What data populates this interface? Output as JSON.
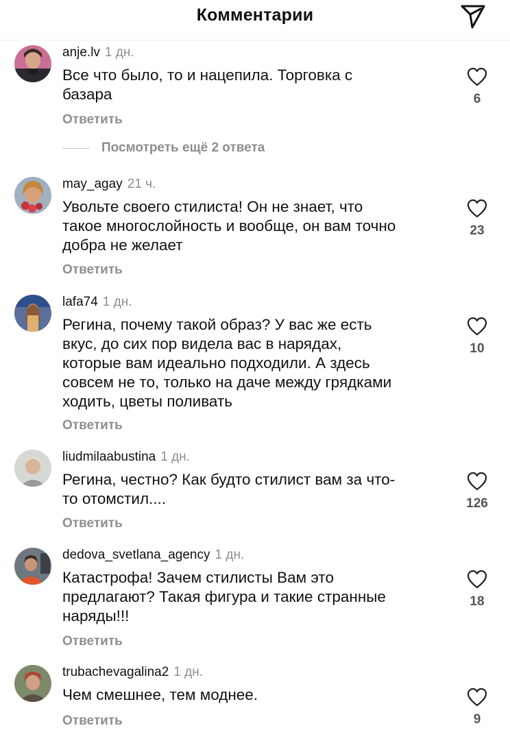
{
  "header": {
    "title": "Комментарии",
    "send_icon": "send-icon"
  },
  "colors": {
    "text": "#111111",
    "secondary": "#8e8e8e",
    "heart_outline": "#222222"
  },
  "comments": [
    {
      "username": "anje.lv",
      "time": "1 дн.",
      "text": "Все что было, то и нацепила. Торговка с\nбазара",
      "reply_label": "Ответить",
      "likes": "6"
    },
    {
      "username": "may_agay",
      "time": "21 ч.",
      "text": "Увольте своего стилиста! Он не знает, что\nтакое многослойность и вообще, он вам точно\nдобра не желает",
      "reply_label": "Ответить",
      "likes": "23"
    },
    {
      "username": "lafa74",
      "time": "1 дн.",
      "text": "Регина, почему такой образ? У вас же есть\nвкус, до сих пор видела вас в нарядах,\nкоторые  вам идеально подходили. А здесь\nсовсем не то, только на даче между грядками\nходить, цветы поливать",
      "reply_label": "Ответить",
      "likes": "10"
    },
    {
      "username": "liudmilaabustina",
      "time": "1 дн.",
      "text": "Регина, честно? Как будто стилист вам за что-\nто отомстил....",
      "reply_label": "Ответить",
      "likes": "126"
    },
    {
      "username": "dedova_svetlana_agency",
      "time": "1 дн.",
      "text": "Катастрофа! Зачем  стилисты Вам это\nпредлагают? Такая фигура и такие странные\nнаряды!!!",
      "reply_label": "Ответить",
      "likes": "18"
    },
    {
      "username": "trubachevagalina2",
      "time": "1 дн.",
      "text": "Чем смешнее, тем моднее.",
      "reply_label": "Ответить",
      "likes": "9"
    }
  ],
  "view_replies": {
    "label": "Посмотреть ещё 2 ответа"
  }
}
